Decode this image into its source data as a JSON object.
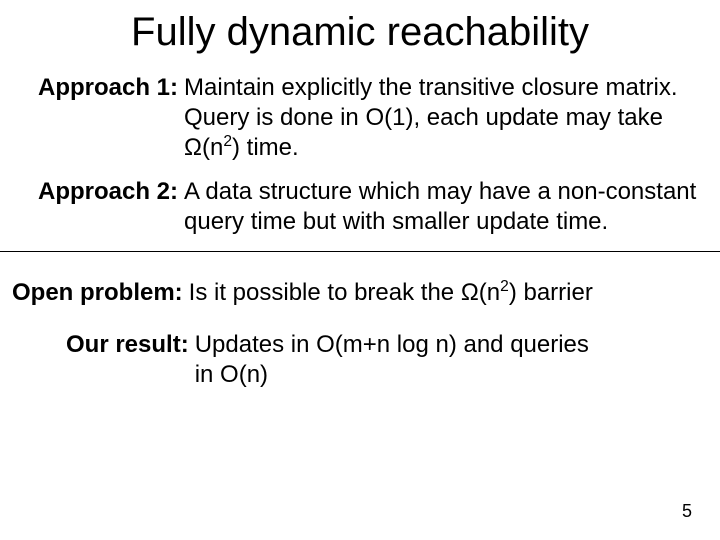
{
  "title": "Fully dynamic reachability",
  "approach1": {
    "label": "Approach 1:",
    "body_pre": "Maintain explicitly the transitive closure matrix. Query is done in O(1), each update may take ",
    "omega": "Ω",
    "body_mid": "(n",
    "exp": "2",
    "body_post": ") time."
  },
  "approach2": {
    "label": "Approach 2:",
    "body": "A data structure which may have a non-constant query time but with smaller update time."
  },
  "open_problem": {
    "label": "Open problem:",
    "body_pre": "Is it possible to break the ",
    "omega": "Ω",
    "body_mid": "(n",
    "exp": "2",
    "body_post": ") barrier"
  },
  "our_result": {
    "label": "Our result:",
    "line1": "Updates in O(m+n log n) and queries",
    "line2": "in O(n)"
  },
  "page_number": "5"
}
